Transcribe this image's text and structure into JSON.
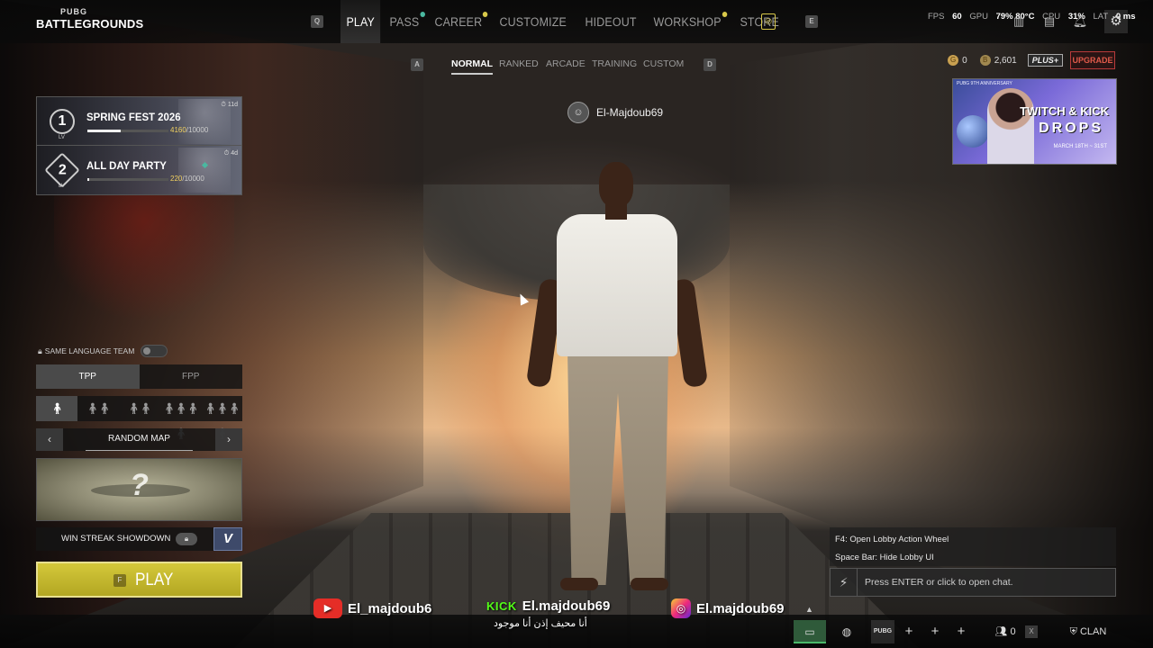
{
  "logo": {
    "line1": "PUBG",
    "line2": "BATTLEGROUNDS"
  },
  "nav": {
    "key_left": "Q",
    "key_right": "E",
    "items": [
      {
        "label": "PLAY",
        "active": true
      },
      {
        "label": "PASS",
        "dot": "teal"
      },
      {
        "label": "CAREER",
        "dot": "gold"
      },
      {
        "label": "CUSTOMIZE"
      },
      {
        "label": "HIDEOUT"
      },
      {
        "label": "WORKSHOP",
        "dot": "gold"
      },
      {
        "label": "STORE"
      }
    ]
  },
  "stats": {
    "fps_label": "FPS",
    "fps": "60",
    "gpu_label": "GPU",
    "gpu": "79%",
    "gpu_temp": "80°C",
    "cpu_label": "CPU",
    "cpu": "31%",
    "lat_label": "LAT",
    "lat": "0 ms"
  },
  "modes": {
    "key_left": "A",
    "key_right": "D",
    "items": [
      "NORMAL",
      "RANKED",
      "ARCADE",
      "TRAINING",
      "CUSTOM"
    ],
    "active": "NORMAL"
  },
  "player": {
    "name": "El-Majdoub69"
  },
  "currency": {
    "g_coin": "0",
    "bp": "2,601",
    "plus_label": "PLUS+",
    "upgrade_label": "UPGRADE"
  },
  "promo": {
    "small_text": "PUBG 9TH ANNIVERSARY",
    "title1": "TWITCH & KICK",
    "title2": "DROPS",
    "date": "MARCH 18TH ~ 31ST"
  },
  "events": [
    {
      "level": "1",
      "lv_label": "LV",
      "title": "SPRING FEST 2026",
      "current": "4160",
      "total": "/10000",
      "progress": 0.416,
      "days": "11d"
    },
    {
      "level": "2",
      "lv_label": "LV",
      "title": "ALL DAY PARTY",
      "current": "220",
      "total": "/10000",
      "progress": 0.022,
      "days": "4d"
    }
  ],
  "play_panel": {
    "same_language_team": "SAME LANGUAGE TEAM",
    "perspectives": [
      "TPP",
      "FPP"
    ],
    "active_perspective": "TPP",
    "squad_sizes": [
      "1",
      "2",
      "3",
      "4",
      "4+"
    ],
    "active_squad": 0,
    "map_name": "RANDOM MAP",
    "map_placeholder": "?",
    "win_streak": "WIN STREAK SHOWDOWN",
    "v_label": "V",
    "play_key": "F",
    "play_label": "PLAY"
  },
  "hints": {
    "line1": "F4: Open Lobby Action Wheel",
    "line2": "Space Bar: Hide Lobby UI"
  },
  "chat": {
    "placeholder": "Press ENTER or click to open chat."
  },
  "bottom": {
    "squad_label": "PUBG",
    "friends_count": "0",
    "key_x": "X",
    "clan_label": "CLAN"
  },
  "overlay": {
    "youtube_name": "El_majdoub6",
    "kick_label": "KICK",
    "kick_name": "El.majdoub69",
    "kick_sub": "أنا محيف إذن أنا موجود",
    "instagram_name": "El.majdoub69"
  },
  "colors": {
    "play_button": "#c8bc30",
    "upgrade": "#b83a3a",
    "kick": "#53fc18",
    "youtube": "#e52d27"
  },
  "icons": [
    "gear-icon",
    "bell-icon",
    "news-icon",
    "gift-icon",
    "lock-icon",
    "bolt-icon",
    "chat-icon",
    "globe-icon",
    "friends-icon",
    "clan-icon"
  ]
}
